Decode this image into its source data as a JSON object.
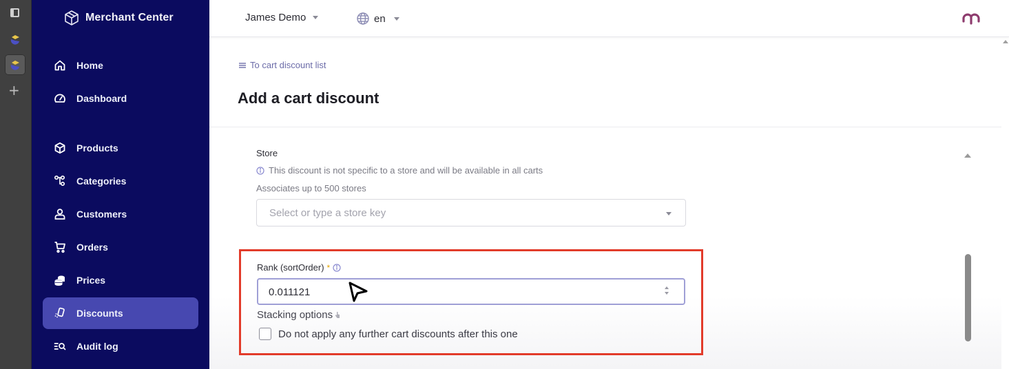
{
  "app": {
    "brand_name": "Merchant Center"
  },
  "dock": {
    "items": [
      {
        "icon": "window-icon"
      },
      {
        "icon": "app-icon"
      },
      {
        "icon": "app-icon-active"
      },
      {
        "icon": "plus-icon"
      }
    ],
    "plus_glyph": "+"
  },
  "sidebar": {
    "items": [
      {
        "label": "Home",
        "icon": "home-icon",
        "active": false
      },
      {
        "label": "Dashboard",
        "icon": "dashboard-icon",
        "active": false
      },
      {
        "label": "Products",
        "icon": "cube-icon",
        "active": false
      },
      {
        "label": "Categories",
        "icon": "categories-icon",
        "active": false
      },
      {
        "label": "Customers",
        "icon": "user-icon",
        "active": false
      },
      {
        "label": "Orders",
        "icon": "cart-icon",
        "active": false
      },
      {
        "label": "Prices",
        "icon": "coins-icon",
        "active": false
      },
      {
        "label": "Discounts",
        "icon": "discount-icon",
        "active": true
      },
      {
        "label": "Audit log",
        "icon": "audit-log-icon",
        "active": false
      }
    ]
  },
  "topbar": {
    "project": "James Demo",
    "language": "en"
  },
  "page": {
    "back_link": "To cart discount list",
    "title": "Add a cart discount"
  },
  "form": {
    "store": {
      "label": "Store",
      "info": "This discount is not specific to a store and will be available in all carts",
      "hint": "Associates up to 500 stores",
      "placeholder": "Select or type a store key"
    },
    "rank": {
      "label": "Rank (sortOrder)",
      "required_marker": "*",
      "value": "0.011121"
    },
    "stacking": {
      "label": "Stacking options",
      "checkbox_label": "Do not apply any further cart discounts after this one",
      "checked": false
    }
  },
  "colors": {
    "sidebar_bg": "#0b0b5f",
    "active_nav": "#4748b0",
    "highlight": "#e23b2a",
    "link": "#6b6ba8",
    "user_logo": "#8e3c6e"
  }
}
